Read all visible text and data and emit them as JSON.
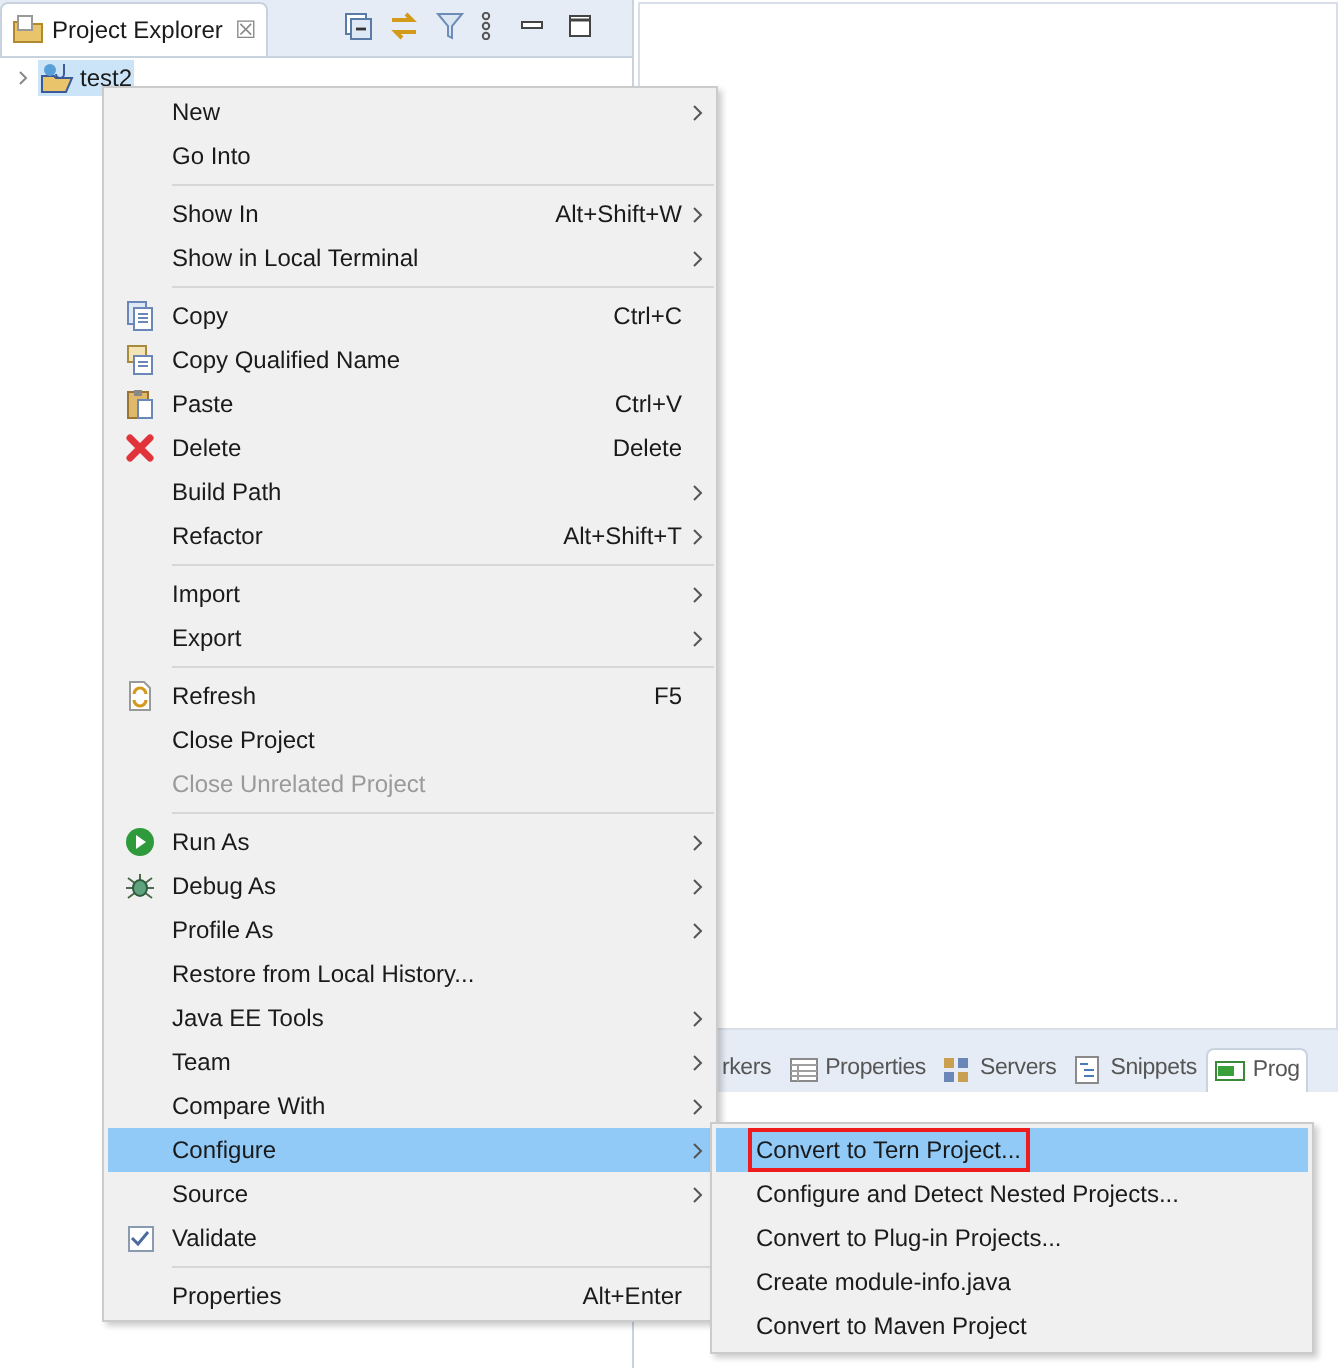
{
  "explorer": {
    "tab_title": "Project Explorer",
    "close": "☒",
    "tree": [
      {
        "label": "test2",
        "expanded": false,
        "selected": true
      }
    ]
  },
  "bottom_tabs": [
    {
      "label": "rkers",
      "selected": false
    },
    {
      "label": "Properties",
      "selected": false
    },
    {
      "label": "Servers",
      "selected": false
    },
    {
      "label": "Snippets",
      "selected": false
    },
    {
      "label": "Prog",
      "selected": true
    }
  ],
  "context_menu": [
    {
      "kind": "plain",
      "label": "New",
      "has_submenu": true,
      "disabled": false,
      "selected": false
    },
    {
      "kind": "plain",
      "label": "Go Into",
      "has_submenu": false,
      "disabled": false,
      "selected": false
    },
    {
      "kind": "separator"
    },
    {
      "kind": "plain",
      "label": "Show In",
      "shortcut": "Alt+Shift+W",
      "has_submenu": true,
      "disabled": false,
      "selected": false
    },
    {
      "kind": "plain",
      "label": "Show in Local Terminal",
      "has_submenu": true,
      "disabled": false,
      "selected": false
    },
    {
      "kind": "separator"
    },
    {
      "kind": "copy",
      "label": "Copy",
      "shortcut": "Ctrl+C",
      "has_submenu": false,
      "disabled": false,
      "selected": false
    },
    {
      "kind": "copyname",
      "label": "Copy Qualified Name",
      "has_submenu": false,
      "disabled": false,
      "selected": false
    },
    {
      "kind": "paste",
      "label": "Paste",
      "shortcut": "Ctrl+V",
      "has_submenu": false,
      "disabled": false,
      "selected": false
    },
    {
      "kind": "delete",
      "label": "Delete",
      "shortcut": "Delete",
      "has_submenu": false,
      "disabled": false,
      "selected": false
    },
    {
      "kind": "plain",
      "label": "Build Path",
      "has_submenu": true,
      "disabled": false,
      "selected": false
    },
    {
      "kind": "plain",
      "label": "Refactor",
      "shortcut": "Alt+Shift+T",
      "has_submenu": true,
      "disabled": false,
      "selected": false
    },
    {
      "kind": "separator"
    },
    {
      "kind": "plain",
      "label": "Import",
      "has_submenu": true,
      "disabled": false,
      "selected": false
    },
    {
      "kind": "plain",
      "label": "Export",
      "has_submenu": true,
      "disabled": false,
      "selected": false
    },
    {
      "kind": "separator"
    },
    {
      "kind": "refresh",
      "label": "Refresh",
      "shortcut": "F5",
      "has_submenu": false,
      "disabled": false,
      "selected": false
    },
    {
      "kind": "plain",
      "label": "Close Project",
      "has_submenu": false,
      "disabled": false,
      "selected": false
    },
    {
      "kind": "plain",
      "label": "Close Unrelated Project",
      "has_submenu": false,
      "disabled": true,
      "selected": false
    },
    {
      "kind": "separator"
    },
    {
      "kind": "run",
      "label": "Run As",
      "has_submenu": true,
      "disabled": false,
      "selected": false
    },
    {
      "kind": "debug",
      "label": "Debug As",
      "has_submenu": true,
      "disabled": false,
      "selected": false
    },
    {
      "kind": "plain",
      "label": "Profile As",
      "has_submenu": true,
      "disabled": false,
      "selected": false
    },
    {
      "kind": "plain",
      "label": "Restore from Local History...",
      "has_submenu": false,
      "disabled": false,
      "selected": false
    },
    {
      "kind": "plain",
      "label": "Java EE Tools",
      "has_submenu": true,
      "disabled": false,
      "selected": false
    },
    {
      "kind": "plain",
      "label": "Team",
      "has_submenu": true,
      "disabled": false,
      "selected": false
    },
    {
      "kind": "plain",
      "label": "Compare With",
      "has_submenu": true,
      "disabled": false,
      "selected": false
    },
    {
      "kind": "plain",
      "label": "Configure",
      "has_submenu": true,
      "disabled": false,
      "selected": true
    },
    {
      "kind": "plain",
      "label": "Source",
      "has_submenu": true,
      "disabled": false,
      "selected": false
    },
    {
      "kind": "check",
      "label": "Validate",
      "checked": true,
      "has_submenu": false,
      "disabled": false,
      "selected": false
    },
    {
      "kind": "separator"
    },
    {
      "kind": "plain",
      "label": "Properties",
      "shortcut": "Alt+Enter",
      "has_submenu": false,
      "disabled": false,
      "selected": false
    }
  ],
  "submenu": [
    {
      "label": "Convert to Tern Project...",
      "selected": true,
      "annotated": true
    },
    {
      "label": "Configure and Detect Nested Projects...",
      "selected": false,
      "annotated": false
    },
    {
      "label": "Convert to Plug-in Projects...",
      "selected": false,
      "annotated": false
    },
    {
      "label": "Create module-info.java",
      "selected": false,
      "annotated": false
    },
    {
      "label": "Convert to Maven Project",
      "selected": false,
      "annotated": false
    }
  ]
}
